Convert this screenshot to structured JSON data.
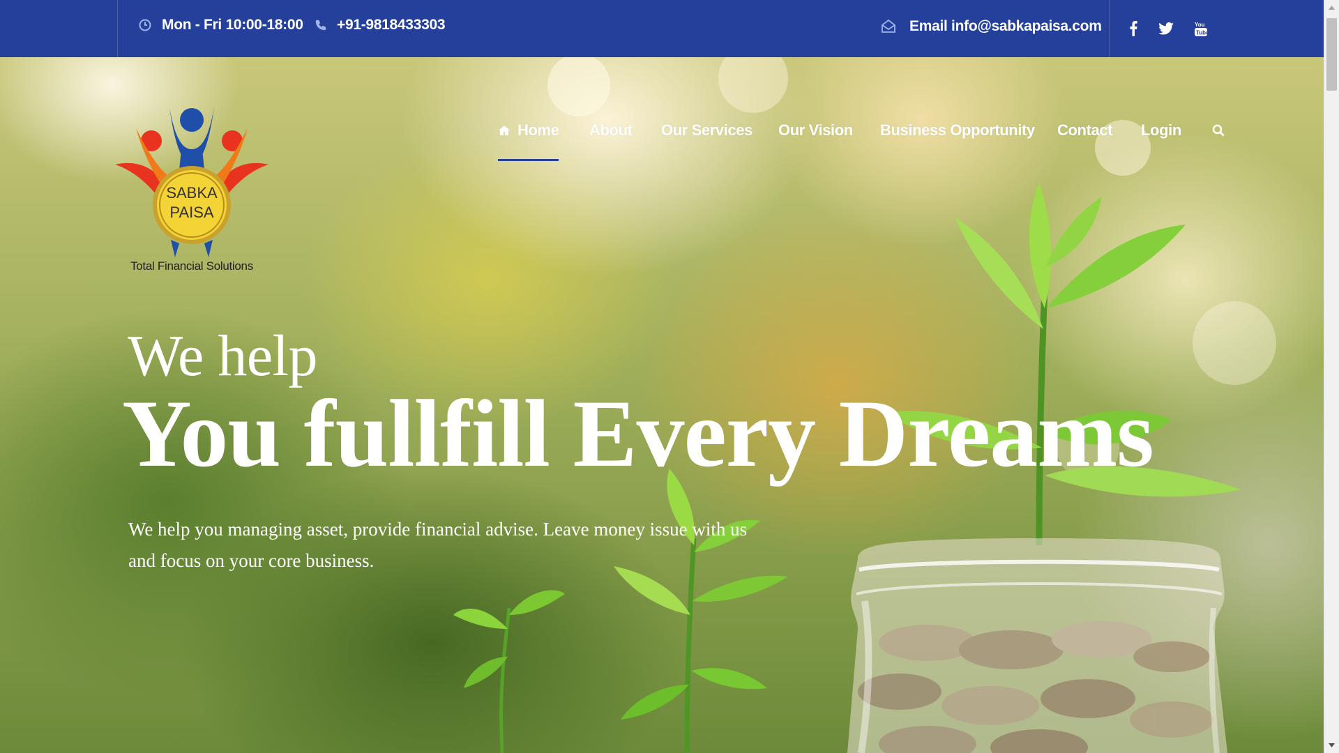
{
  "topbar": {
    "hours": "Mon - Fri 10:00-18:00",
    "phone": "+91-9818433303",
    "email": "Email info@sabkapaisa.com",
    "social": [
      "facebook-icon",
      "twitter-icon",
      "youtube-icon"
    ]
  },
  "logo": {
    "line1": "SABKA",
    "line2": "PAISA",
    "tagline": "Total Financial Solutions"
  },
  "nav": {
    "items": [
      {
        "label": "Home",
        "active": true
      },
      {
        "label": "About"
      },
      {
        "label": "Our Services"
      },
      {
        "label": "Our Vision"
      },
      {
        "label": "Business Opportunity"
      },
      {
        "label": "Contact"
      },
      {
        "label": "Login"
      }
    ],
    "search_icon": "search-icon"
  },
  "hero": {
    "pre_title": "We help",
    "title": "You fullfill Every Dreams",
    "subtitle": "We help you managing asset, provide financial advise. Leave money issue with us and focus on your core business."
  },
  "colors": {
    "brand_blue": "#25409a",
    "white": "#ffffff"
  }
}
